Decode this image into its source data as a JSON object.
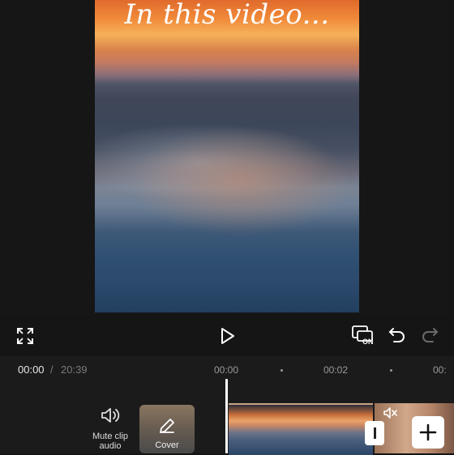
{
  "preview": {
    "overlay_text": "In this video..."
  },
  "controls": {
    "fullscreen_icon": "fullscreen-icon",
    "play_icon": "play-icon",
    "ai_caption_icon": "auto-captions-icon",
    "ai_caption_badge": "ON",
    "undo_icon": "undo-icon",
    "redo_icon": "redo-icon"
  },
  "timeline": {
    "current_time": "00:00",
    "separator": "/",
    "total_time": "20:39",
    "ruler": [
      "00:00",
      "00:02",
      "00:"
    ],
    "mute_tool": {
      "label_line1": "Mute clip",
      "label_line2": "audio"
    },
    "cover": {
      "label": "Cover"
    }
  },
  "colors": {
    "background": "#151515",
    "timeline_bg": "#1b1b1b",
    "playhead": "#ffffff",
    "clip_border": "#c9a583"
  }
}
